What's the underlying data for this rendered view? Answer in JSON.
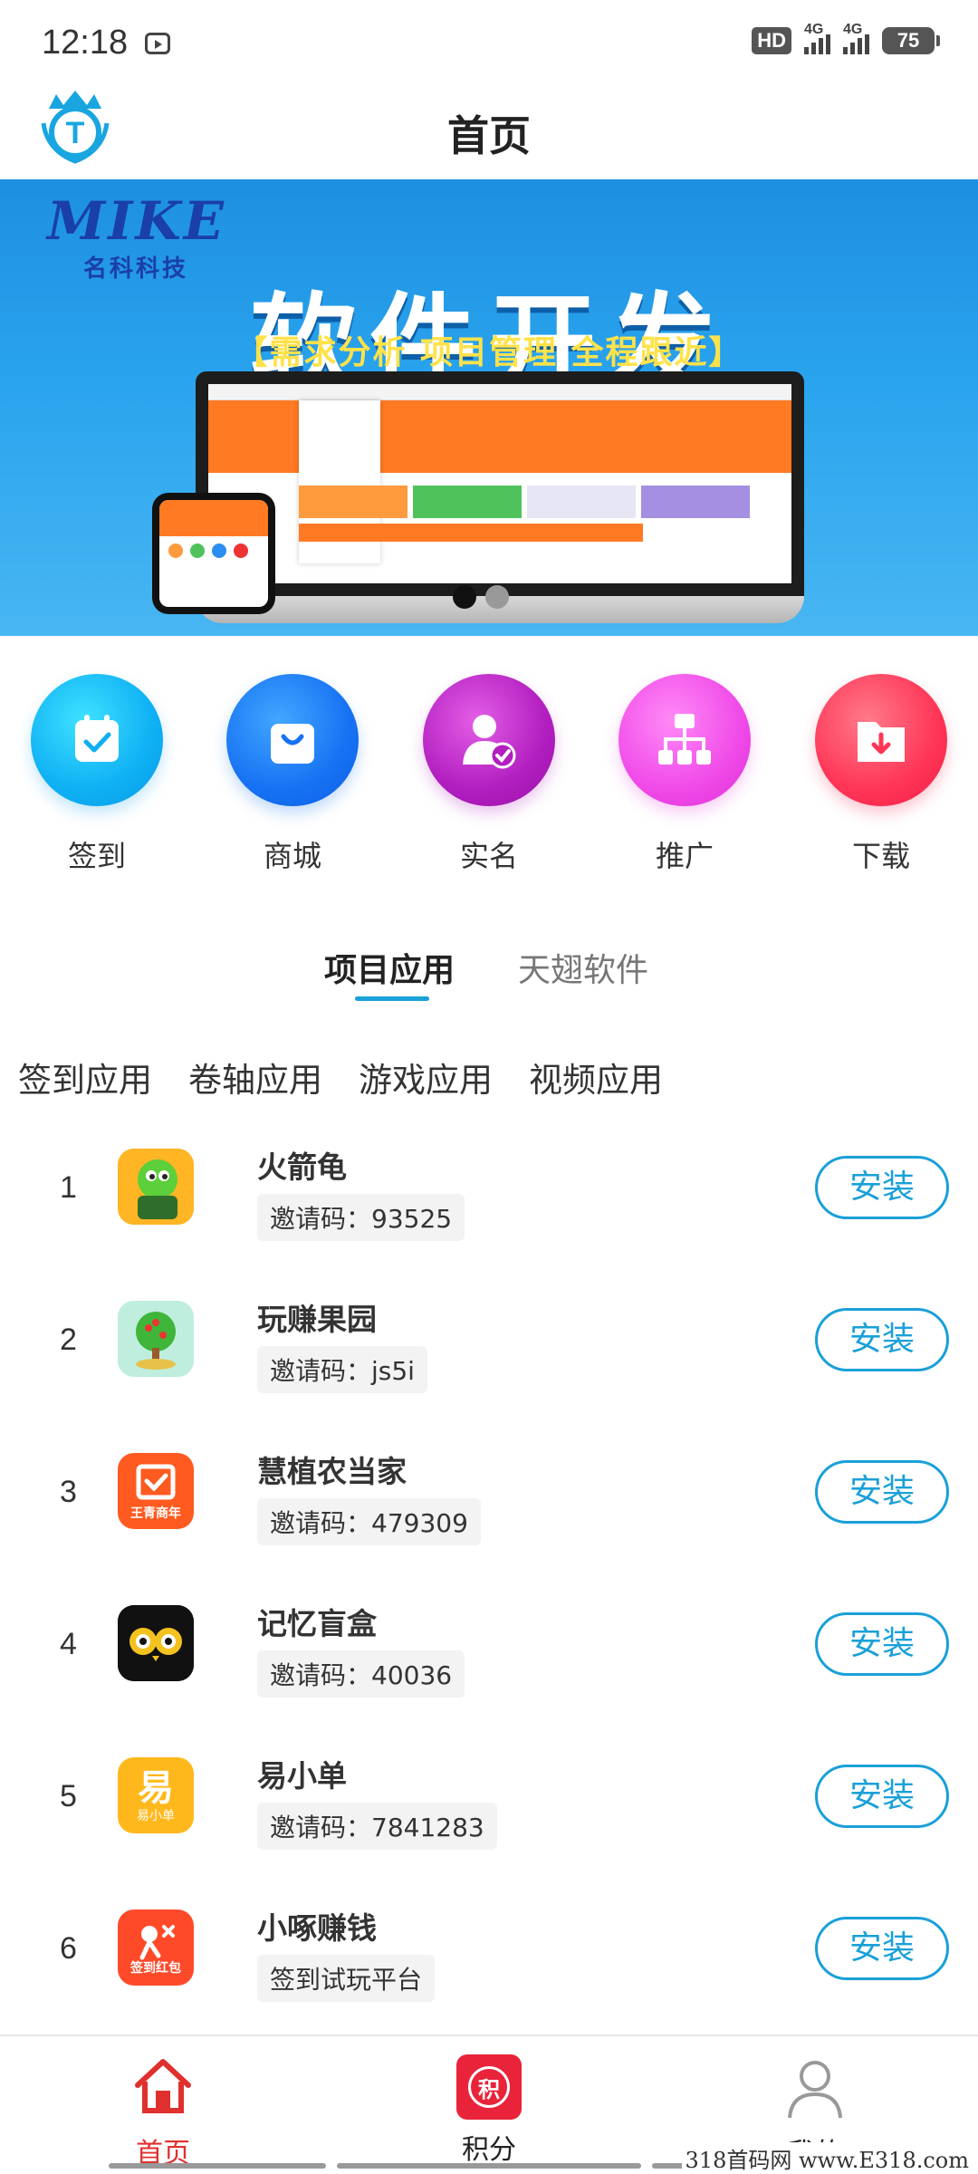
{
  "status_bar": {
    "time": "12:18",
    "hd_label": "HD",
    "network_1": "4G",
    "network_2": "4G",
    "battery": "75"
  },
  "header": {
    "title": "首页"
  },
  "banner": {
    "brand": "MIKE",
    "brand_sub": "名科科技",
    "headline": "软件开发",
    "tagline": "【需求分析 项目管理 全程跟近】",
    "slide_count": 2,
    "active_slide": 0
  },
  "quick_actions": [
    {
      "label": "签到",
      "icon": "calendar-check-icon",
      "color": "#0fb0f4"
    },
    {
      "label": "商城",
      "icon": "shopping-bag-icon",
      "color": "#1772f3"
    },
    {
      "label": "实名",
      "icon": "verified-user-icon",
      "color": "#b21ec0"
    },
    {
      "label": "推广",
      "icon": "org-chart-icon",
      "color": "#f04ae8"
    },
    {
      "label": "下载",
      "icon": "download-folder-icon",
      "color": "#ff3556"
    }
  ],
  "tabs": [
    {
      "label": "项目应用",
      "active": true
    },
    {
      "label": "天翅软件",
      "active": false
    }
  ],
  "categories": [
    "签到应用",
    "卷轴应用",
    "游戏应用",
    "视频应用"
  ],
  "install_label": "安装",
  "apps": [
    {
      "rank": "1",
      "name": "火箭龟",
      "code": "邀请码：93525"
    },
    {
      "rank": "2",
      "name": "玩赚果园",
      "code": "邀请码：js5i"
    },
    {
      "rank": "3",
      "name": "慧植农当家",
      "code": "邀请码：479309"
    },
    {
      "rank": "4",
      "name": "记忆盲盒",
      "code": "邀请码：40036"
    },
    {
      "rank": "5",
      "name": "易小单",
      "code": "邀请码：7841283"
    },
    {
      "rank": "6",
      "name": "小啄赚钱",
      "code": "签到试玩平台"
    }
  ],
  "app_icon_texts": {
    "huizhi": "王青商年",
    "yixiaodan": "易",
    "yixiaodan_sub": "易小单",
    "xiaozhuo": "签到红包"
  },
  "bottom_nav": [
    {
      "label": "首页",
      "icon": "home-icon",
      "active": true
    },
    {
      "label": "积分",
      "icon": "points-icon",
      "active": false
    },
    {
      "label": "我的",
      "icon": "profile-icon",
      "active": false
    }
  ],
  "points_glyph": "积",
  "accent_color": "#1aa0d8",
  "active_nav_color": "#e0302e",
  "watermark": "318首码网 www.E318.com"
}
